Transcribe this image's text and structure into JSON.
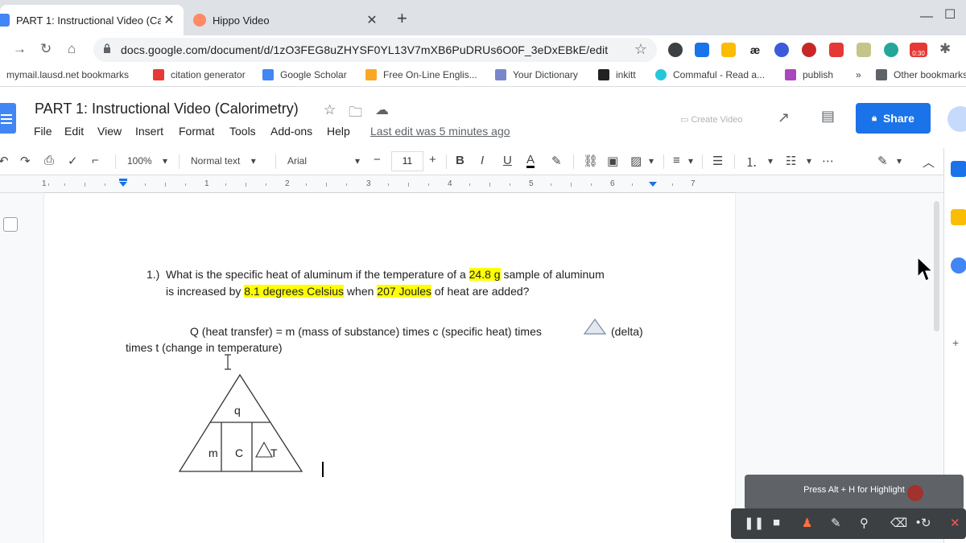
{
  "browser": {
    "tabs": [
      {
        "title": "PART 1: Instructional Video (Calc",
        "close": "✕",
        "active": true
      },
      {
        "title": "Hippo Video",
        "close": "✕",
        "active": false
      }
    ],
    "new_tab": "+",
    "url": "docs.google.com/document/d/1zO3FEG8uZHYSF0YL13V7mXB6PuDRUs6O0F_3eDxEBkE/edit",
    "extension_badge": "0:30",
    "bookmarks": [
      "mymail.lausd.net bookmarks",
      "citation generator",
      "Google Scholar",
      "Free On-Line Englis...",
      "Your Dictionary",
      "inkitt",
      "Commaful - Read a...",
      "publish",
      "»",
      "Other bookmarks"
    ]
  },
  "docs": {
    "title": "PART 1: Instructional Video (Calorimetry)",
    "menu": [
      "File",
      "Edit",
      "View",
      "Insert",
      "Format",
      "Tools",
      "Add-ons",
      "Help"
    ],
    "last_edit": "Last edit was 5 minutes ago",
    "create_video": "Create Video",
    "share": "Share",
    "toolbar": {
      "zoom": "100%",
      "style": "Normal text",
      "font": "Arial",
      "font_size": "11",
      "minus": "−",
      "plus": "+",
      "bold": "B",
      "italic": "I",
      "underline": "U",
      "text_color": "A",
      "more": "⋯"
    },
    "ruler": [
      "1",
      "1",
      "2",
      "3",
      "4",
      "5",
      "6",
      "7"
    ]
  },
  "document": {
    "q_number": "1.)",
    "q_line1": {
      "a": "What is the specific heat of aluminum if the temperature of a ",
      "h1": "24.8 g",
      "b": " sample of aluminum"
    },
    "q_line2": {
      "a": "is increased by ",
      "h1": "8.1 degrees Celsius",
      "b": " when ",
      "h2": "207 Joules",
      "c": " of heat are added?"
    },
    "formula_line1a": "Q (heat transfer) = m (mass of substance) times c (specific heat) times",
    "formula_line1b": "(delta)",
    "formula_line2": "times t (change in temperature)",
    "triangle": {
      "top": "q",
      "left": "m",
      "middle": "C",
      "right": "T"
    }
  },
  "recorder": {
    "tip": "Press Alt + H for Highlight",
    "close": "✕"
  },
  "colors": {
    "share": "#1a73e8",
    "highlight": "#ffff00",
    "tab_strip": "#dee1e6",
    "recorder_bar": "#3c4043"
  }
}
